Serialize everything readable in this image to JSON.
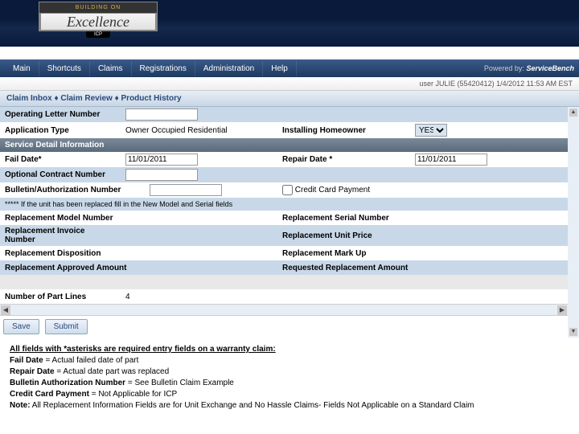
{
  "logo": {
    "top": "BUILDING ON",
    "middle": "Excellence",
    "bottom": "ICP"
  },
  "nav": {
    "items": [
      "Main",
      "Shortcuts",
      "Claims",
      "Registrations",
      "Administration",
      "Help"
    ],
    "powered": "Powered by:",
    "brand": "ServiceBench"
  },
  "user": {
    "label": "user JULIE (55420412)",
    "ts": "1/4/2012 11:53 AM EST"
  },
  "breadcrumb": {
    "a": "Claim Inbox",
    "b": "Claim Review",
    "c": "Product History",
    "sep": " ♦ "
  },
  "sections": {
    "operlet": "Operating Letter Number",
    "apptype_l": "Application Type",
    "apptype_v": "Owner Occupied Residential",
    "insthome_l": "Installing Homeowner",
    "insthome_v": "YES",
    "svc_header": "Service Detail Information",
    "fail_l": "Fail Date*",
    "fail_v": "11/01/2011",
    "repair_l": "Repair Date *",
    "repair_v": "11/01/2011",
    "opt_l": "Optional Contract Number",
    "bull_l": "Bulletin/Authorization Number",
    "cc_l": "Credit Card Payment",
    "note": "***** If the unit has been replaced fill in the New Model and Serial fields",
    "rmodel": "Replacement Model Number",
    "rserial": "Replacement Serial Number",
    "rinv": "Replacement Invoice Number",
    "runit": "Replacement Unit Price",
    "rdisp": "Replacement Disposition",
    "rmark": "Replacement Mark Up",
    "ramt": "Replacement Approved Amount",
    "rreq": "Requested Replacement Amount",
    "parts_l": "Number of Part Lines",
    "parts_v": "4"
  },
  "buttons": {
    "save": "Save",
    "submit": "Submit"
  },
  "instructions": {
    "title": "All fields with *asterisks are required entry fields on a warranty claim:",
    "l1a": "Fail Date",
    "l1b": " = Actual failed date of part",
    "l2a": "Repair Date",
    "l2b": " = Actual date part was replaced",
    "l3a": "Bulletin Authorization Number",
    "l3b": " = See Bulletin Claim Example",
    "l4a": "Credit Card Payment",
    "l4b": " = Not  Applicable for ICP",
    "l5a": "Note:",
    "l5b": "  All Replacement Information Fields are for Unit Exchange and No Hassle Claims- Fields Not Applicable on a Standard Claim"
  }
}
